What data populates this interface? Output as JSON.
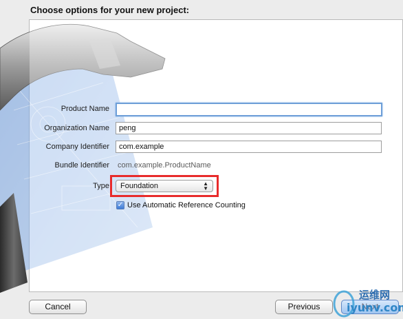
{
  "header": {
    "title": "Choose options for your new project:"
  },
  "form": {
    "product_name": {
      "label": "Product Name",
      "value": ""
    },
    "organization_name": {
      "label": "Organization Name",
      "value": "peng"
    },
    "company_identifier": {
      "label": "Company Identifier",
      "value": "com.example"
    },
    "bundle_identifier": {
      "label": "Bundle Identifier",
      "value": "com.example.ProductName"
    },
    "type": {
      "label": "Type",
      "selected": "Foundation"
    },
    "arc": {
      "label": "Use Automatic Reference Counting",
      "checked": true
    }
  },
  "buttons": {
    "cancel": "Cancel",
    "previous": "Previous",
    "next": "Next"
  },
  "watermark": {
    "line1": "运维网",
    "line2": "iyunv.com"
  },
  "colors": {
    "highlight": "#e82b2b",
    "focus": "#6e9fd8",
    "blueprint": "#4a7fd0"
  },
  "icons": [
    "hammer-icon",
    "blueprint-icon",
    "popup-arrows-icon",
    "checkmark-icon"
  ]
}
